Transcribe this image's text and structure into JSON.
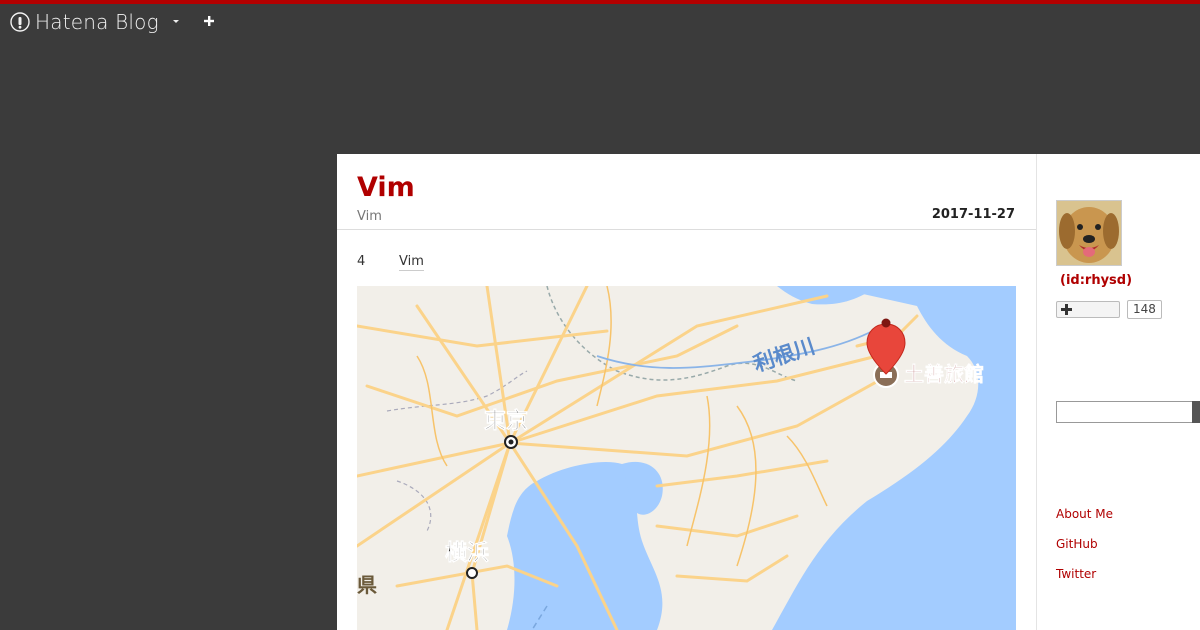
{
  "navbar": {
    "brand": "Hatena Blog",
    "menu_icon": "caret-down-icon",
    "add_icon": "plus-icon",
    "accent_color": "#b30000"
  },
  "article": {
    "title": "Vim",
    "category": "Vim",
    "date": "2017-11-27",
    "meta_count": "4",
    "meta_tag": "Vim",
    "map": {
      "labels": {
        "tokyo": "東京",
        "yokohama": "横浜",
        "tone_river": "利根川",
        "prefecture": "県",
        "inn": "土善旅館"
      },
      "colors": {
        "land": "#f2efe9",
        "water": "#a3ccff",
        "road": "#fbd38a",
        "pin": "#e8463b"
      }
    }
  },
  "sidebar": {
    "user_id": "(id:rhysd)",
    "follow_count": "148",
    "search_placeholder": "",
    "links": [
      "About Me",
      "GitHub",
      "Twitter"
    ]
  }
}
